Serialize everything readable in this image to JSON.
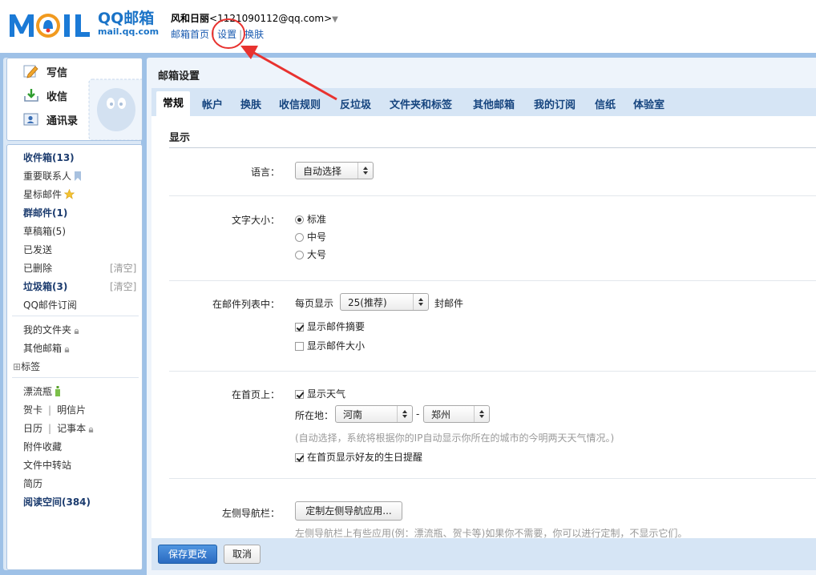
{
  "header": {
    "brand_cn": "QQ邮箱",
    "brand_url": "mail.qq.com",
    "user_name": "风和日丽",
    "user_email": "<1121090112@qq.com>",
    "dropdown_glyph": "▼",
    "links": [
      "邮箱首页",
      "设置",
      "换肤"
    ],
    "link_sep": "|"
  },
  "compose": {
    "write": "写信",
    "inbox": "收信",
    "contacts": "通讯录"
  },
  "folders": {
    "inbox": "收件箱(13)",
    "important": "重要联系人",
    "starred": "星标邮件",
    "group": "群邮件(1)",
    "drafts": "草稿箱(5)",
    "sent": "已发送",
    "deleted": "已删除",
    "spam": "垃圾箱(3)",
    "subscriptions": "QQ邮件订阅",
    "clear": "[清空]",
    "my_folders": "我的文件夹",
    "other_mailbox": "其他邮箱",
    "tags": "标签",
    "tags_expand": "⊞",
    "drift_bottle": "漂流瓶",
    "greeting_card": "贺卡",
    "postcard": "明信片",
    "calendar": "日历",
    "notepad": "记事本",
    "attachments": "附件收藏",
    "file_transfer": "文件中转站",
    "resume": "简历",
    "reading_space": "阅读空间(384)",
    "item_sep": "|"
  },
  "main": {
    "title": "邮箱设置",
    "tabs": [
      "常规",
      "帐户",
      "换肤",
      "收信规则",
      "反垃圾",
      "文件夹和标签",
      "其他邮箱",
      "我的订阅",
      "信纸",
      "体验室"
    ],
    "section": "显示",
    "language_label": "语言：",
    "language_value": "自动选择",
    "fontsize_label": "文字大小：",
    "fontsize_options": [
      "标准",
      "中号",
      "大号"
    ],
    "list_label": "在邮件列表中：",
    "per_page_prefix": "每页显示",
    "per_page_value": "25(推荐)",
    "per_page_suffix": "封邮件",
    "show_summary": "显示邮件摘要",
    "show_size": "显示邮件大小",
    "homepage_label": "在首页上：",
    "show_weather": "显示天气",
    "location_label": "所在地：",
    "province": "河南",
    "location_dash": "-",
    "city": "郑州",
    "weather_hint": "(自动选择，系统将根据你的IP自动显示你所在的城市的今明两天天气情况。)",
    "birthday": "在首页显示好友的生日提醒",
    "nav_label": "左侧导航栏：",
    "nav_button": "定制左侧导航应用...",
    "nav_hint": "左侧导航栏上有些应用(例：漂流瓶、贺卡等)如果你不需要，你可以进行定制，不显示它们。",
    "save": "保存更改",
    "cancel": "取消"
  },
  "colors": {
    "frame": "#9ec1e7",
    "tab_bar": "#d6e5f5",
    "primary_button": "#2a6ac1",
    "annotation": "#e8322f",
    "link": "#1a5bb0"
  }
}
